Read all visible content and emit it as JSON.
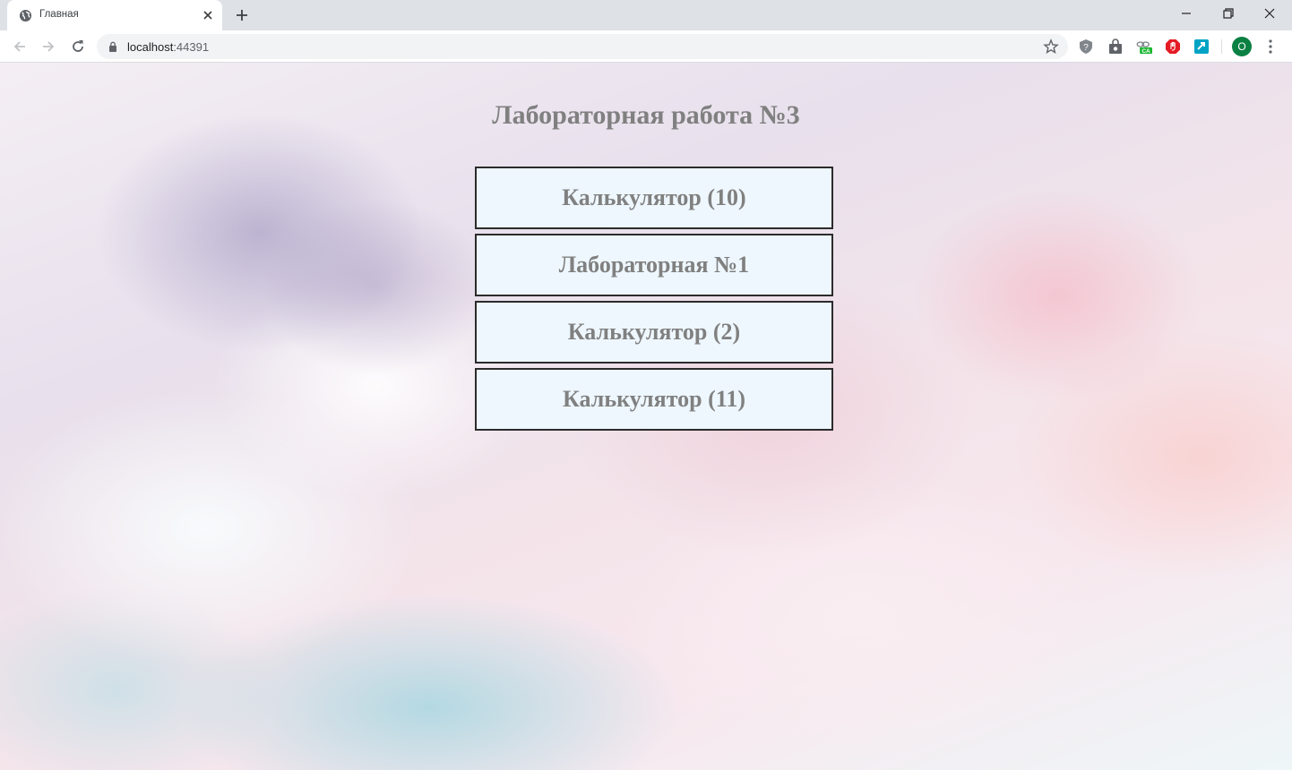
{
  "browser": {
    "tab_title": "Главная",
    "url_host": "localhost",
    "url_port": ":44391",
    "profile_initial": "O",
    "extension_badge": "CA"
  },
  "page": {
    "heading": "Лабораторная работа №3",
    "links": [
      {
        "label": "Калькулятор (10)"
      },
      {
        "label": "Лабораторная №1"
      },
      {
        "label": "Калькулятор (2)"
      },
      {
        "label": "Калькулятор (11)"
      }
    ]
  }
}
